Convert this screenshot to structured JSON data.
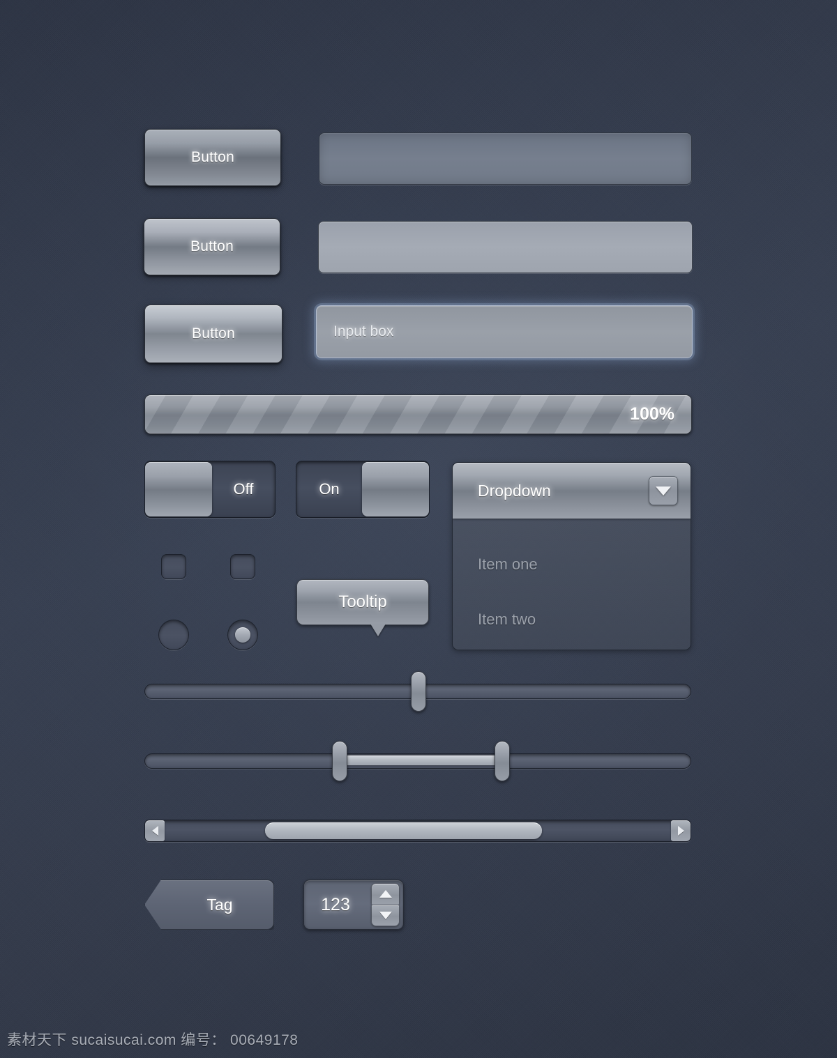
{
  "buttons": [
    {
      "label": "Button",
      "state": "normal"
    },
    {
      "label": "Button",
      "state": "hover"
    },
    {
      "label": "Button",
      "state": "active"
    }
  ],
  "inputs": [
    {
      "value": "",
      "placeholder": "",
      "state": "normal"
    },
    {
      "value": "",
      "placeholder": "",
      "state": "hover"
    },
    {
      "value": "Input box",
      "placeholder": "Input box",
      "state": "focused"
    }
  ],
  "progress": {
    "label": "100%",
    "percent": 100,
    "striped": true
  },
  "toggles": [
    {
      "label": "Off",
      "checked": false,
      "knob_side": "left"
    },
    {
      "label": "On",
      "checked": true,
      "knob_side": "right"
    }
  ],
  "dropdown": {
    "selected": "Dropdown",
    "arrow_icon": "chevron-down-icon",
    "items": [
      {
        "label": "Item one"
      },
      {
        "label": "Item two"
      }
    ]
  },
  "checkboxes": [
    {
      "checked": false
    },
    {
      "checked": false
    }
  ],
  "radios": [
    {
      "checked": false
    },
    {
      "checked": true
    }
  ],
  "tooltip": {
    "text": "Tooltip"
  },
  "sliders": [
    {
      "type": "single",
      "value": 49,
      "handles": [
        49
      ]
    },
    {
      "type": "range",
      "values": [
        36,
        66
      ],
      "handles": [
        36,
        66
      ]
    }
  ],
  "scrollbar": {
    "left_arrow_icon": "caret-left-icon",
    "right_arrow_icon": "caret-right-icon",
    "thumb_start": 22,
    "thumb_size": 50
  },
  "tag": {
    "label": "Tag"
  },
  "spinner": {
    "value": "123",
    "up_icon": "caret-up-icon",
    "down_icon": "caret-down-icon"
  },
  "watermark": {
    "text": "素材天下 sucaisucai.com  编号： 00649178"
  },
  "colors": {
    "background": "#333a4b",
    "control_light": "#b3b8c0",
    "control_dark": "#6e757f",
    "focus_glow": "#8ca5cd",
    "text_primary": "#ffffff",
    "text_muted": "#9ba1ab"
  }
}
